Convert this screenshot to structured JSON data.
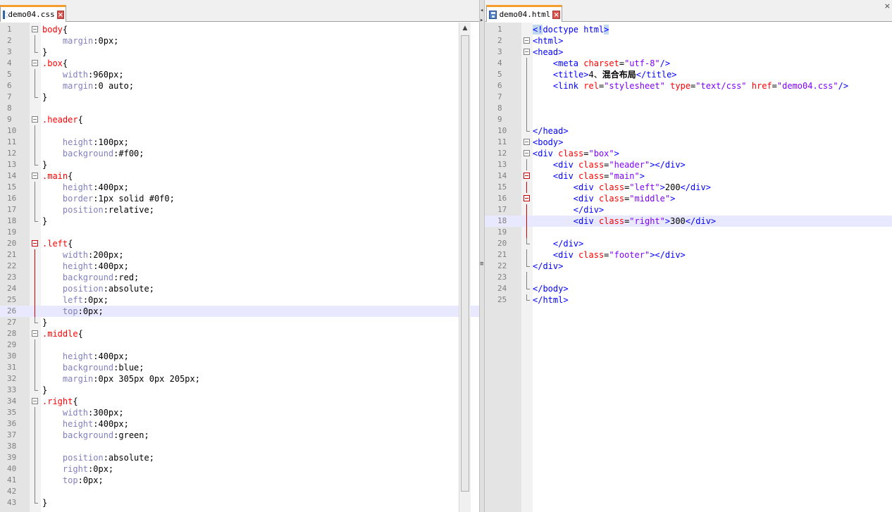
{
  "left_tab": {
    "title": "demo04.css",
    "close": "×"
  },
  "right_tab": {
    "title": "demo04.html",
    "close": "×"
  },
  "scroll": {
    "up": "▲",
    "down": "▼",
    "grip": "≡",
    "nav_left": "◂",
    "nav_right": "▸",
    "pane_close": "×"
  },
  "css_lines": [
    {
      "n": "1",
      "html": "<span class=\"sel\">body</span>{"
    },
    {
      "n": "2",
      "html": "    <span class=\"p\">margin</span>:0px;"
    },
    {
      "n": "3",
      "html": "}"
    },
    {
      "n": "4",
      "html": "<span class=\"sel\">.box</span>{"
    },
    {
      "n": "5",
      "html": "    <span class=\"p\">width</span>:960px;"
    },
    {
      "n": "6",
      "html": "    <span class=\"p\">margin</span>:0 auto;"
    },
    {
      "n": "7",
      "html": "}"
    },
    {
      "n": "8",
      "html": ""
    },
    {
      "n": "9",
      "html": "<span class=\"sel\">.header</span>{"
    },
    {
      "n": "10",
      "html": ""
    },
    {
      "n": "11",
      "html": "    <span class=\"p\">height</span>:100px;"
    },
    {
      "n": "12",
      "html": "    <span class=\"p\">background</span>:#f00;"
    },
    {
      "n": "13",
      "html": "}"
    },
    {
      "n": "14",
      "html": "<span class=\"sel\">.main</span>{"
    },
    {
      "n": "15",
      "html": "    <span class=\"p\">height</span>:400px;"
    },
    {
      "n": "16",
      "html": "    <span class=\"p\">border</span>:1px solid #0f0;"
    },
    {
      "n": "17",
      "html": "    <span class=\"p\">position</span>:relative;"
    },
    {
      "n": "18",
      "html": "}"
    },
    {
      "n": "19",
      "html": ""
    },
    {
      "n": "20",
      "html": "<span class=\"sel\">.left</span>{"
    },
    {
      "n": "21",
      "html": "    <span class=\"p\">width</span>:200px;"
    },
    {
      "n": "22",
      "html": "    <span class=\"p\">height</span>:400px;"
    },
    {
      "n": "23",
      "html": "    <span class=\"p\">background</span>:red;"
    },
    {
      "n": "24",
      "html": "    <span class=\"p\">position</span>:absolute;"
    },
    {
      "n": "25",
      "html": "    <span class=\"p\">left</span>:0px;"
    },
    {
      "n": "26",
      "html": "    <span class=\"p\">top</span>:0px;"
    },
    {
      "n": "27",
      "html": "}"
    },
    {
      "n": "28",
      "html": "<span class=\"sel\">.middle</span>{"
    },
    {
      "n": "29",
      "html": ""
    },
    {
      "n": "30",
      "html": "    <span class=\"p\">height</span>:400px;"
    },
    {
      "n": "31",
      "html": "    <span class=\"p\">background</span>:blue;"
    },
    {
      "n": "32",
      "html": "    <span class=\"p\">margin</span>:0px 305px 0px 205px;"
    },
    {
      "n": "33",
      "html": "}"
    },
    {
      "n": "34",
      "html": "<span class=\"sel\">.right</span>{"
    },
    {
      "n": "35",
      "html": "    <span class=\"p\">width</span>:300px;"
    },
    {
      "n": "36",
      "html": "    <span class=\"p\">height</span>:400px;"
    },
    {
      "n": "37",
      "html": "    <span class=\"p\">background</span>:green;"
    },
    {
      "n": "38",
      "html": ""
    },
    {
      "n": "39",
      "html": "    <span class=\"p\">position</span>:absolute;"
    },
    {
      "n": "40",
      "html": "    <span class=\"p\">right</span>:0px;"
    },
    {
      "n": "41",
      "html": "    <span class=\"p\">top</span>:0px;"
    },
    {
      "n": "42",
      "html": ""
    },
    {
      "n": "43",
      "html": "}"
    }
  ],
  "html_lines": [
    {
      "n": "1",
      "html": "<span class=\"k sh\">&lt;!</span><span class=\"k\">doctype html</span><span class=\"k sh\">&gt;</span>"
    },
    {
      "n": "2",
      "html": "<span class=\"k\">&lt;html&gt;</span>"
    },
    {
      "n": "3",
      "html": "<span class=\"k\">&lt;head&gt;</span>"
    },
    {
      "n": "4",
      "html": "    <span class=\"k\">&lt;meta</span> <span class=\"a\">charset</span>=<span class=\"s\">\"utf-8\"</span><span class=\"k\">/&gt;</span>"
    },
    {
      "n": "5",
      "html": "    <span class=\"k\">&lt;title&gt;</span>4、<b>混合布局</b><span class=\"k\">&lt;/title&gt;</span>"
    },
    {
      "n": "6",
      "html": "    <span class=\"k\">&lt;link</span> <span class=\"a\">rel</span>=<span class=\"s\">\"stylesheet\"</span> <span class=\"a\">type</span>=<span class=\"s\">\"text/css\"</span> <span class=\"a\">href</span>=<span class=\"s\">\"demo04.css\"</span><span class=\"k\">/&gt;</span>"
    },
    {
      "n": "7",
      "html": ""
    },
    {
      "n": "8",
      "html": ""
    },
    {
      "n": "9",
      "html": ""
    },
    {
      "n": "10",
      "html": "<span class=\"k\">&lt;/head&gt;</span>"
    },
    {
      "n": "11",
      "html": "<span class=\"k\">&lt;body&gt;</span>"
    },
    {
      "n": "12",
      "html": "<span class=\"k\">&lt;div</span> <span class=\"a\">class</span>=<span class=\"s\">\"box\"</span><span class=\"k\">&gt;</span>"
    },
    {
      "n": "13",
      "html": "    <span class=\"k\">&lt;div</span> <span class=\"a\">class</span>=<span class=\"s\">\"header\"</span><span class=\"k\">&gt;&lt;/div&gt;</span>"
    },
    {
      "n": "14",
      "html": "    <span class=\"k\">&lt;div</span> <span class=\"a\">class</span>=<span class=\"s\">\"main\"</span><span class=\"k\">&gt;</span>"
    },
    {
      "n": "15",
      "html": "        <span class=\"k\">&lt;div</span> <span class=\"a\">class</span>=<span class=\"s\">\"left\"</span><span class=\"k\">&gt;</span>200<span class=\"k\">&lt;/div&gt;</span>"
    },
    {
      "n": "16",
      "html": "        <span class=\"k\">&lt;div</span> <span class=\"a\">class</span>=<span class=\"s\">\"middle\"</span><span class=\"k\">&gt;</span>"
    },
    {
      "n": "17",
      "html": "        <span class=\"k\">&lt;/div&gt;</span>"
    },
    {
      "n": "18",
      "html": "        <span class=\"k\">&lt;div</span> <span class=\"a\">class</span>=<span class=\"s\">\"right\"</span><span class=\"k\">&gt;</span>300<span class=\"k\">&lt;/div&gt;</span>"
    },
    {
      "n": "19",
      "html": ""
    },
    {
      "n": "20",
      "html": "    <span class=\"k\">&lt;/div&gt;</span>"
    },
    {
      "n": "21",
      "html": "    <span class=\"k\">&lt;div</span> <span class=\"a\">class</span>=<span class=\"s\">\"footer\"</span><span class=\"k\">&gt;&lt;/div&gt;</span>"
    },
    {
      "n": "22",
      "html": "<span class=\"k\">&lt;/div&gt;</span>"
    },
    {
      "n": "23",
      "html": ""
    },
    {
      "n": "24",
      "html": "<span class=\"k\">&lt;/body&gt;</span>"
    },
    {
      "n": "25",
      "html": "<span class=\"k\">&lt;/html&gt;</span>"
    }
  ]
}
